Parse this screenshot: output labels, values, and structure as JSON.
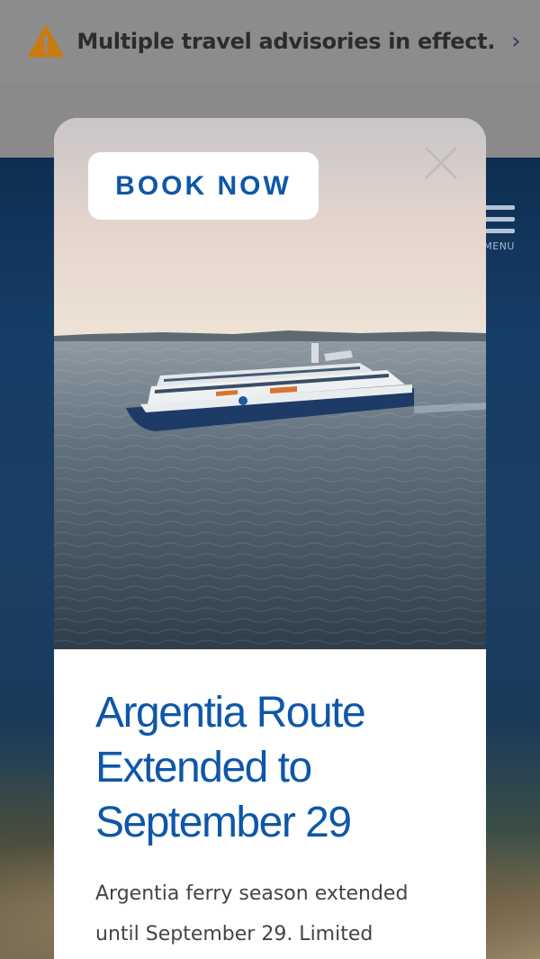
{
  "advisory": {
    "text": "Multiple travel advisories in effect.",
    "chevron": "›",
    "icon": "warning-icon",
    "icon_color": "#e8900a"
  },
  "header": {
    "menu_label": "MENU"
  },
  "modal": {
    "book_label": "BOOK NOW",
    "close_icon": "close-icon",
    "title": "Argentia Route Extended to September 29",
    "description": "Argentia ferry season extended until September 29. Limited",
    "accent_color": "#0e57a8"
  }
}
